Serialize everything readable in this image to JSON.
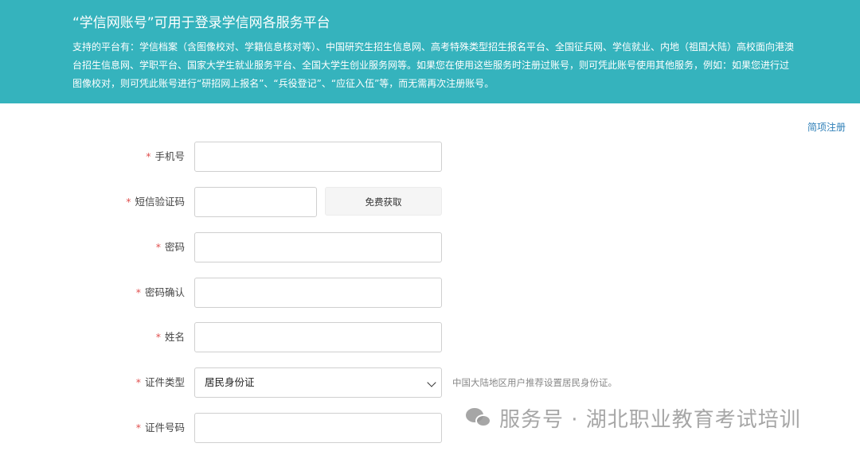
{
  "banner": {
    "title": "“学信网账号”可用于登录学信网各服务平台",
    "description": "支持的平台有：学信档案（含图像校对、学籍信息核对等）、中国研究生招生信息网、高考特殊类型招生报名平台、全国征兵网、学信就业、内地（祖国大陆）高校面向港澳台招生信息网、学职平台、国家大学生就业服务平台、全国大学生创业服务网等。如果您在使用这些服务时注册过账号，则可凭此账号使用其他服务，例如：如果您进行过图像校对，则可凭此账号进行“研招网上报名”、“兵役登记”、“应征入伍”等，而无需再次注册账号。"
  },
  "side_link": "简项注册",
  "form": {
    "required_mark": "*",
    "phone_label": "手机号",
    "sms_label": "短信验证码",
    "sms_button": "免费获取",
    "password_label": "密码",
    "password_confirm_label": "密码确认",
    "name_label": "姓名",
    "id_type_label": "证件类型",
    "id_type_value": "居民身份证",
    "id_type_hint": "中国大陆地区用户推荐设置居民身份证。",
    "id_number_label": "证件号码"
  },
  "watermark": {
    "text": "服务号 · 湖北职业教育考试培训",
    "icon": "wechat-icon"
  }
}
